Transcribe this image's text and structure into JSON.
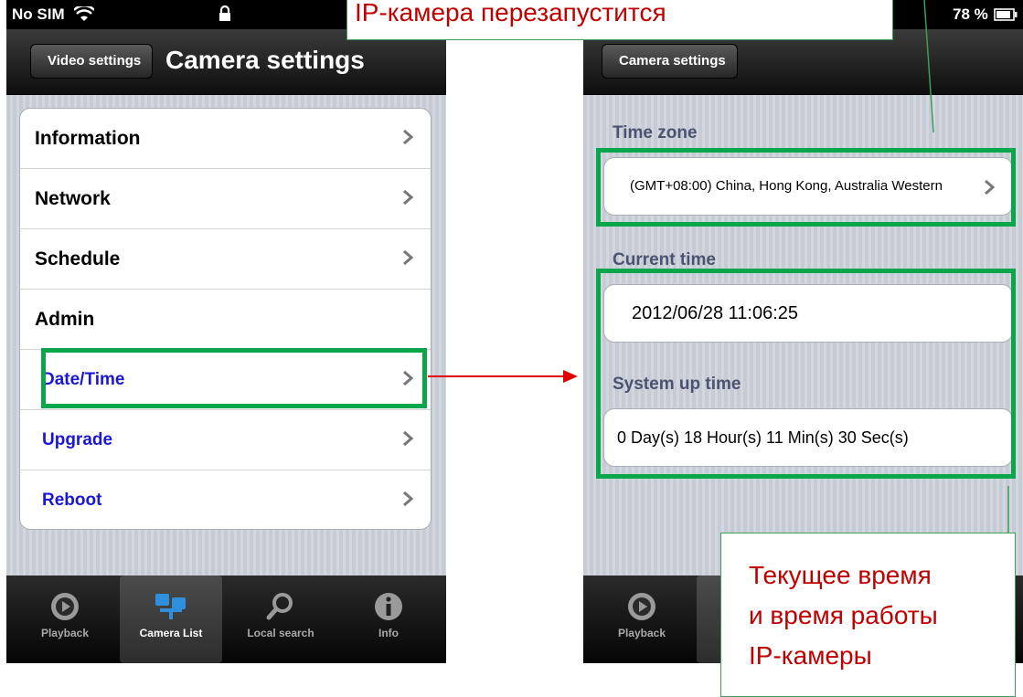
{
  "left_screen": {
    "status": {
      "carrier": "No SIM"
    },
    "nav": {
      "back": "Video settings",
      "title": "Camera settings"
    },
    "menu": [
      {
        "label": "Information",
        "chevron": true
      },
      {
        "label": "Network",
        "chevron": true
      },
      {
        "label": "Schedule",
        "chevron": true
      },
      {
        "label": "Admin",
        "chevron": false
      },
      {
        "label": "Date/Time",
        "chevron": true
      },
      {
        "label": "Upgrade",
        "chevron": true
      },
      {
        "label": "Reboot",
        "chevron": true
      }
    ],
    "tabs": [
      {
        "label": "Playback",
        "icon": "playback-icon"
      },
      {
        "label": "Camera List",
        "icon": "camera-list-icon",
        "selected": true
      },
      {
        "label": "Local search",
        "icon": "search-icon"
      },
      {
        "label": "Info",
        "icon": "info-icon"
      }
    ]
  },
  "right_screen": {
    "status": {
      "battery": "78 %"
    },
    "nav": {
      "back": "Camera settings"
    },
    "time_zone": {
      "header": "Time zone",
      "value": "(GMT+08:00) China, Hong Kong, Australia Western"
    },
    "current_time": {
      "header": "Current time",
      "value": "2012/06/28 11:06:25"
    },
    "system_up_time": {
      "header": "System up time",
      "value": "0 Day(s) 18 Hour(s) 11 Min(s) 30 Sec(s)"
    },
    "tabs": [
      {
        "label": "Playback",
        "icon": "playback-icon"
      }
    ]
  },
  "callouts": {
    "top": "IP-камера перезапустится",
    "bottom": [
      "Текущее время",
      "и время работы",
      "IP-камеры"
    ]
  },
  "colors": {
    "highlight": "#0aa64b",
    "arrow": "#e00000",
    "callout_text": "#c00000",
    "submenu_text": "#1a17d6"
  }
}
